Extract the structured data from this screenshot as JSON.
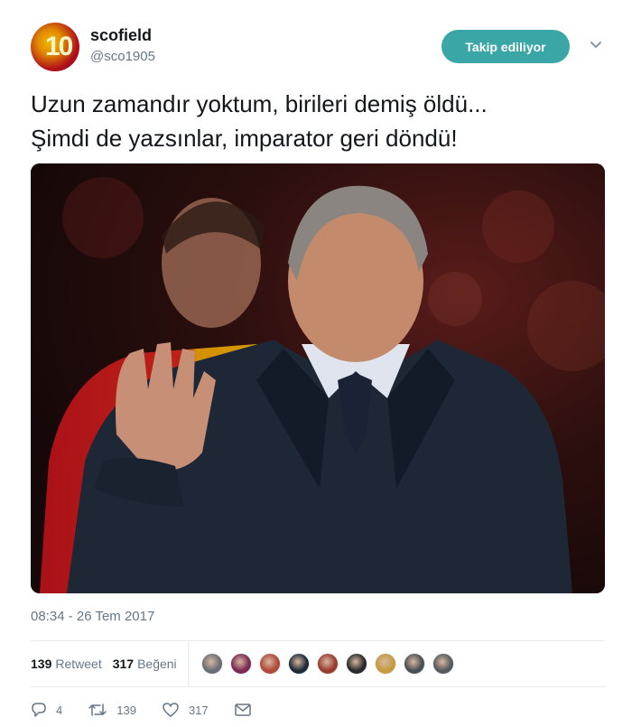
{
  "tweet": {
    "author": {
      "display_name": "scofield",
      "handle": "@sco1905",
      "avatar_text": "10"
    },
    "follow_button_label": "Takip ediliyor",
    "text_lines": [
      "Uzun zamandır yoktum, birileri demiş öldü...",
      "Şimdi de yazsınlar, imparator geri döndü!"
    ],
    "timestamp": "08:34 - 26 Tem 2017",
    "stats": {
      "retweet_count": "139",
      "retweet_label": "Retweet",
      "like_count": "317",
      "like_label": "Beğeni"
    },
    "liker_avatar_colors": [
      "#6b6f75",
      "#7a2a55",
      "#b14a3a",
      "#1f2a38",
      "#9a3b2e",
      "#2a2a2a",
      "#c69a3e",
      "#4a4f55",
      "#55595e"
    ],
    "actions": {
      "reply_count": "4",
      "retweet_count": "139",
      "like_count": "317"
    }
  },
  "icons": {
    "reply": "reply-icon",
    "retweet": "retweet-icon",
    "like": "heart-icon",
    "message": "envelope-icon",
    "menu": "chevron-down-icon"
  },
  "colors": {
    "follow_button": "#3aa6a6",
    "secondary_text": "#657786"
  }
}
